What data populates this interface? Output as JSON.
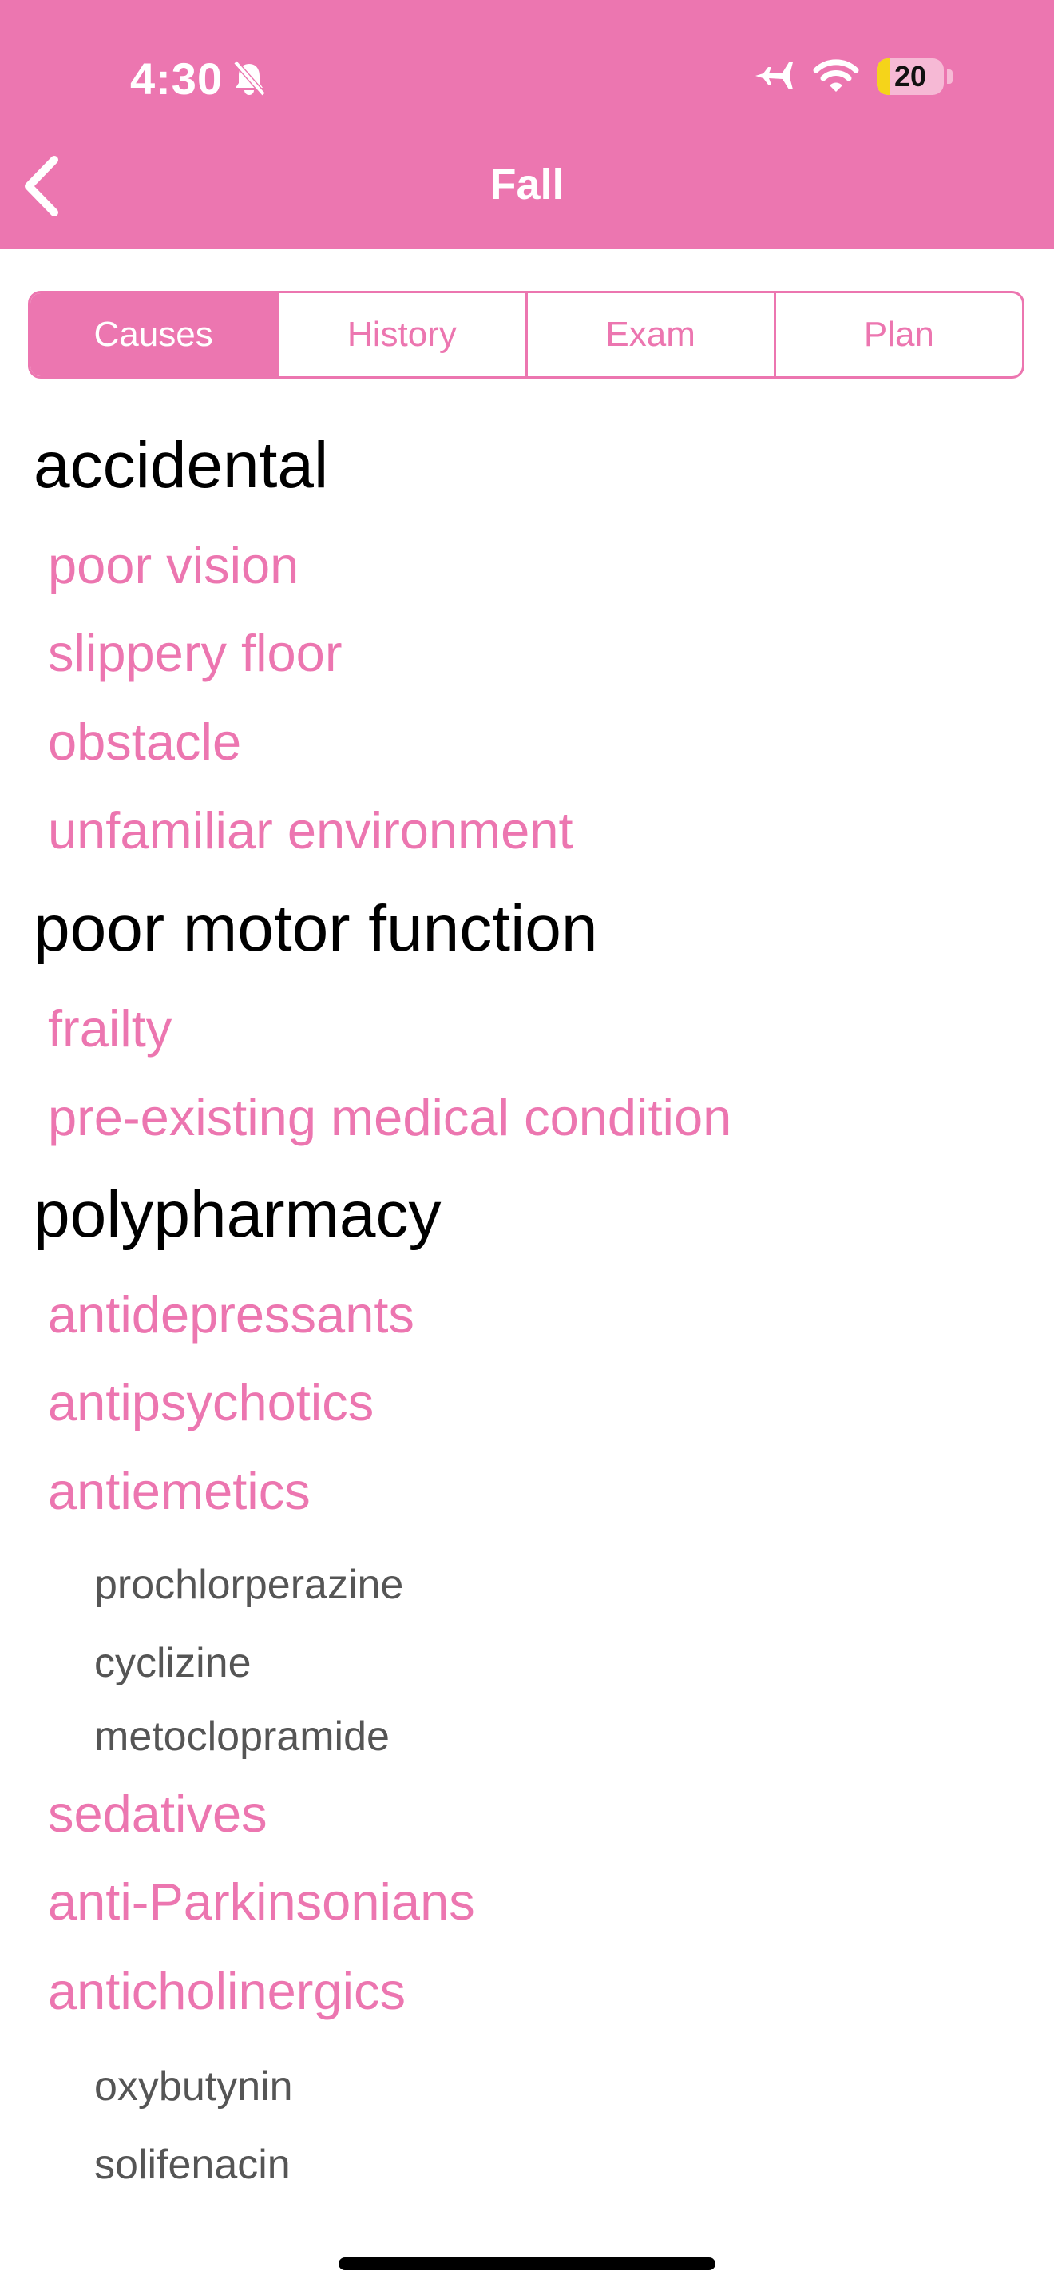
{
  "status_bar": {
    "time": "4:30",
    "battery": "20",
    "battery_level": 0.2
  },
  "nav": {
    "title": "Fall"
  },
  "tabs": [
    {
      "label": "Causes",
      "active": true
    },
    {
      "label": "History",
      "active": false
    },
    {
      "label": "Exam",
      "active": false
    },
    {
      "label": "Plan",
      "active": false
    }
  ],
  "content": {
    "accidental": {
      "title": "accidental",
      "items": [
        "poor vision",
        "slippery floor",
        "obstacle",
        "unfamiliar environment"
      ]
    },
    "motor": {
      "title": "poor motor function",
      "items": [
        "frailty",
        "pre-existing medical condition"
      ]
    },
    "polypharmacy": {
      "title": "polypharmacy",
      "items": [
        "antidepressants",
        "antipsychotics",
        "antiemetics",
        "sedatives",
        "anti-Parkinsonians",
        "anticholinergics"
      ],
      "antiemetics_sub": [
        "prochlorperazine",
        "cyclizine",
        "metoclopramide"
      ],
      "anticholinergics_sub": [
        "oxybutynin",
        "solifenacin"
      ]
    }
  },
  "colors": {
    "accent": "#EC76B0",
    "heading": "#000000",
    "subitem": "#555555"
  },
  "icons": [
    "bell-slash-icon",
    "airplane-icon",
    "wifi-icon",
    "battery-icon",
    "back-chevron-icon"
  ]
}
